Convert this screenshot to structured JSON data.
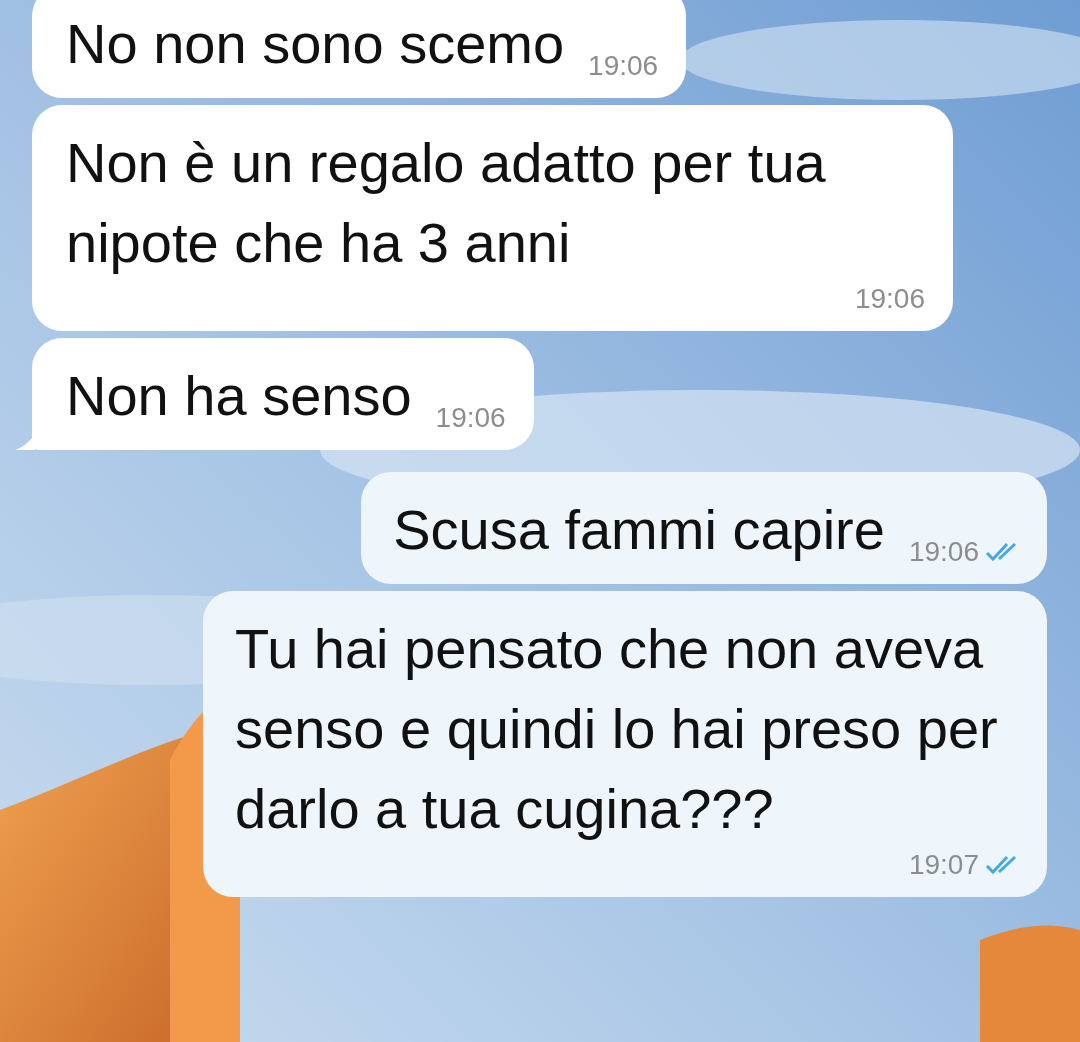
{
  "messages": [
    {
      "kind": "incoming",
      "text": "No non sono scemo",
      "time": "19:06",
      "tail": false
    },
    {
      "kind": "incoming",
      "text": "Non è un regalo adatto per tua nipote che ha 3 anni",
      "time": "19:06",
      "tail": false
    },
    {
      "kind": "incoming",
      "text": "Non ha senso",
      "time": "19:06",
      "tail": true
    },
    {
      "kind": "outgoing",
      "text": "Scusa fammi capire",
      "time": "19:06",
      "read": true
    },
    {
      "kind": "outgoing",
      "text": "Tu hai pensato che non aveva senso e quindi lo hai preso per darlo a tua cugina???",
      "time": "19:07",
      "read": true
    }
  ]
}
